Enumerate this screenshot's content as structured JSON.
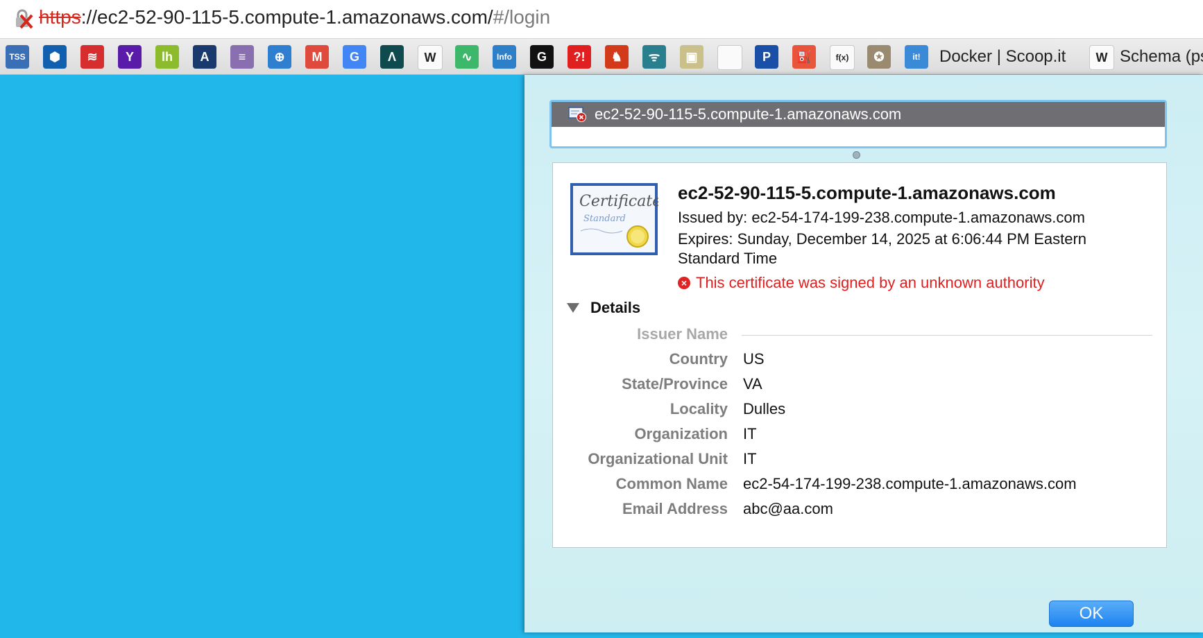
{
  "address_bar": {
    "scheme": "https",
    "rest": "://ec2-52-90-115-5.compute-1.amazonaws.com/",
    "path": "#/login"
  },
  "bookmarks": {
    "icons": [
      {
        "name": "tss-icon",
        "glyph": "TSS",
        "color": "#3a6fb5"
      },
      {
        "name": "chase-icon",
        "glyph": "⬢",
        "color": "#1160b0"
      },
      {
        "name": "bank-of-america-icon",
        "glyph": "≋",
        "color": "#d62e2e"
      },
      {
        "name": "yahoo-icon",
        "glyph": "Y",
        "color": "#5a1ca8"
      },
      {
        "name": "lh-icon",
        "glyph": "lh",
        "color": "#8cbc2c"
      },
      {
        "name": "a-logo-icon",
        "glyph": "A",
        "color": "#1a3a6e"
      },
      {
        "name": "stripes-icon",
        "glyph": "≡",
        "color": "#8a6fb0"
      },
      {
        "name": "globe-target-icon",
        "glyph": "⊕",
        "color": "#2f7fd0"
      },
      {
        "name": "gmail-icon",
        "glyph": "M",
        "color": "#e04a3c"
      },
      {
        "name": "google-icon",
        "glyph": "G",
        "color": "#4285f4"
      },
      {
        "name": "zendesk-icon",
        "glyph": "Λ",
        "color": "#0e4a4e"
      },
      {
        "name": "wikipedia-icon",
        "glyph": "W",
        "color": "#ffffff"
      },
      {
        "name": "green-swirl-icon",
        "glyph": "∿",
        "color": "#3db86a"
      },
      {
        "name": "infoq-icon",
        "glyph": "Info",
        "color": "#2d7fc8"
      },
      {
        "name": "g-black-icon",
        "glyph": "G",
        "color": "#111111"
      },
      {
        "name": "exclaim-question-icon",
        "glyph": "?!",
        "color": "#e02020"
      },
      {
        "name": "red-figure-icon",
        "glyph": "♞",
        "color": "#d23a1a"
      },
      {
        "name": "people-icon",
        "glyph": "ᯤ",
        "color": "#2a7f8f"
      },
      {
        "name": "poster-icon",
        "glyph": "▣",
        "color": "#c9c08a"
      },
      {
        "name": "blank-page-icon",
        "glyph": "",
        "color": "#ffffff"
      },
      {
        "name": "blue-p-icon",
        "glyph": "P",
        "color": "#1a4fa8"
      },
      {
        "name": "fuel-pump-icon",
        "glyph": "⛽",
        "color": "#e8553a"
      },
      {
        "name": "fx-icon",
        "glyph": "f(x)",
        "color": "#ffffff"
      },
      {
        "name": "marine-emblem-icon",
        "glyph": "✪",
        "color": "#9a8a70"
      },
      {
        "name": "scoopit-icon",
        "glyph": "it!",
        "color": "#3a8ad8"
      }
    ],
    "scoopit_label": "Docker | Scoop.it",
    "schema_label": "Schema (ps"
  },
  "sheet": {
    "list_cert_name": "ec2-52-90-115-5.compute-1.amazonaws.com",
    "cert_title": "ec2-52-90-115-5.compute-1.amazonaws.com",
    "issued_by": "Issued by: ec2-54-174-199-238.compute-1.amazonaws.com",
    "expires": "Expires: Sunday, December 14, 2025 at 6:06:44 PM Eastern Standard Time",
    "error_text": "This certificate was signed by an unknown authority",
    "details_label": "Details",
    "issuer_section": "Issuer Name",
    "fields": [
      {
        "label": "Country",
        "value": "US"
      },
      {
        "label": "State/Province",
        "value": "VA"
      },
      {
        "label": "Locality",
        "value": "Dulles"
      },
      {
        "label": "Organization",
        "value": "IT"
      },
      {
        "label": "Organizational Unit",
        "value": "IT"
      },
      {
        "label": "Common Name",
        "value": "ec2-54-174-199-238.compute-1.amazonaws.com"
      },
      {
        "label": "Email Address",
        "value": "abc@aa.com"
      }
    ],
    "ok_label": "OK"
  },
  "colors": {
    "page_background": "#21b7ea",
    "error_red": "#e01e1e",
    "ok_button_blue": "#1e83f0"
  }
}
